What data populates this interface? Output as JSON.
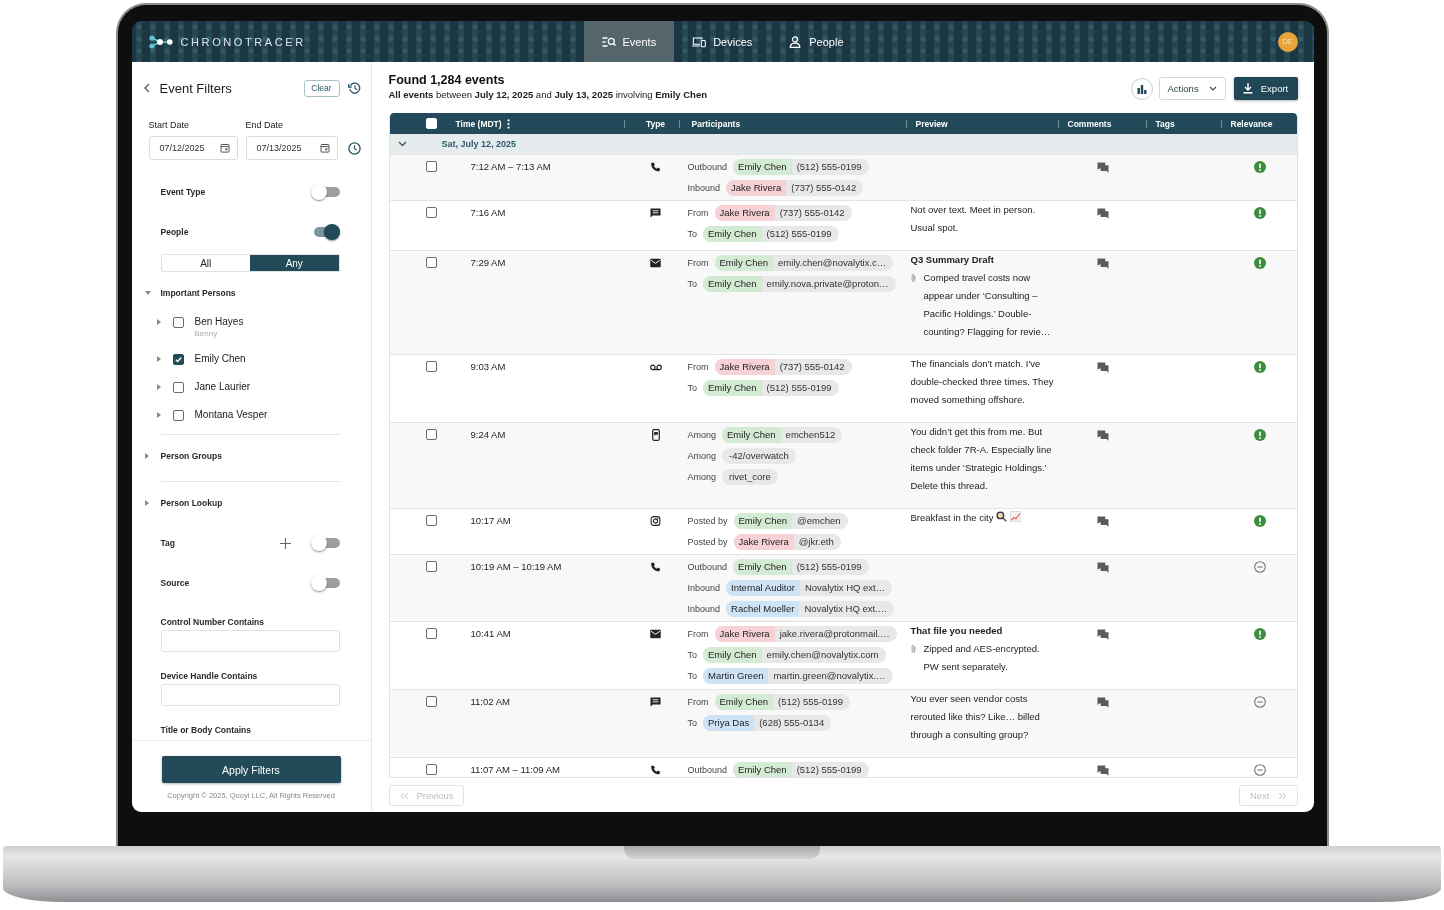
{
  "app": {
    "brand": "CHRONOTRACER",
    "nav": [
      {
        "label": "Events",
        "kind": "events",
        "selected": true
      },
      {
        "label": "Devices",
        "kind": "devices",
        "selected": false
      },
      {
        "label": "People",
        "kind": "people",
        "selected": false
      }
    ],
    "avatar": "DE"
  },
  "sidebar": {
    "title": "Event Filters",
    "clear_label": "Clear",
    "dates": [
      {
        "label": "Start Date",
        "value": "07/12/2025"
      },
      {
        "label": "End Date",
        "value": "07/13/2025"
      }
    ],
    "filters": [
      {
        "kind": "toggle",
        "label": "Event Type",
        "on": false
      },
      {
        "kind": "toggle",
        "label": "People",
        "on": true
      },
      {
        "kind": "segmented",
        "options": [
          {
            "label": "All",
            "selected": false
          },
          {
            "label": "Any",
            "selected": true
          }
        ]
      },
      {
        "kind": "section",
        "label": "Important Persons",
        "expanded": true,
        "children": [
          {
            "name": "Ben Hayes",
            "alias": "Benny",
            "checked": false,
            "expanded": false
          },
          {
            "name": "Emily Chen",
            "checked": true,
            "expanded": false
          },
          {
            "name": "Jane Laurier",
            "checked": false,
            "expanded": false
          },
          {
            "name": "Montana Vesper",
            "checked": false,
            "expanded": false
          }
        ]
      },
      {
        "kind": "section",
        "label": "Person Groups",
        "expanded": false
      },
      {
        "kind": "section",
        "label": "Person Lookup",
        "expanded": false
      },
      {
        "kind": "toggle",
        "label": "Tag",
        "on": false,
        "add_button": true
      },
      {
        "kind": "toggle",
        "label": "Source",
        "on": false
      },
      {
        "kind": "field",
        "label": "Control Number Contains"
      },
      {
        "kind": "field",
        "label": "Device Handle Contains"
      },
      {
        "kind": "heading",
        "label": "Title or Body Contains"
      }
    ],
    "apply_label": "Apply Filters",
    "copyright": "Copyright © 2025, Quoyi LLC, All Rights Reserved"
  },
  "results": {
    "title": "Found 1,284 events",
    "subtitle": "**All events** between **July 12, 2025** and **July 13, 2025** involving **Emily Chen**",
    "actions": [
      {
        "kind": "chart"
      },
      {
        "kind": "menu",
        "label": "Actions"
      },
      {
        "kind": "export",
        "label": "Export"
      }
    ]
  },
  "table": {
    "select_all": {
      "checked": false
    },
    "columns": [
      {
        "label": "Time (MDT)",
        "menu": true
      },
      {
        "label": "Type"
      },
      {
        "label": "Participants"
      },
      {
        "label": "Preview"
      },
      {
        "label": "Comments"
      },
      {
        "label": "Tags"
      },
      {
        "label": "Relevance"
      }
    ],
    "group": {
      "label": "Sat, July 12, 2025",
      "expanded": true
    },
    "rows": [
      {
        "time": "7:12 AM – 7:13 AM",
        "kind": "call",
        "selected": false,
        "participants": [
          {
            "role": "Outbound",
            "name": "Emily Chen",
            "color": "#d4ebd3",
            "handle": "(512) 555-0199"
          },
          {
            "role": "Inbound",
            "name": "Jake Rivera",
            "color": "#f6d1d5",
            "handle": "(737) 555-0142"
          }
        ],
        "flagged": true
      },
      {
        "time": "7:16 AM",
        "kind": "message",
        "selected": false,
        "participants": [
          {
            "role": "From",
            "name": "Jake Rivera",
            "color": "#f6d1d5",
            "handle": "(737) 555-0142"
          },
          {
            "role": "To",
            "name": "Emily Chen",
            "color": "#d4ebd3",
            "handle": "(512) 555-0199"
          }
        ],
        "preview": {
          "text": "Not over text. Meet in person. Usual spot."
        },
        "flagged": true
      },
      {
        "time": "7:29 AM",
        "kind": "email",
        "selected": false,
        "participants": [
          {
            "role": "From",
            "name": "Emily Chen",
            "color": "#d4ebd3",
            "handle": "emily.chen@novalytix.c…"
          },
          {
            "role": "To",
            "name": "Emily Chen",
            "color": "#d4ebd3",
            "handle": "emily.nova.private@proton…"
          }
        ],
        "preview": {
          "title": "Q3 Summary Draft",
          "attachment": true,
          "text": "Comped travel costs now appear under ‘Consulting – Pacific Holdings.’ Double-counting? Flagging for revie…"
        },
        "flagged": true
      },
      {
        "time": "9:03 AM",
        "kind": "voicemail",
        "selected": false,
        "participants": [
          {
            "role": "From",
            "name": "Jake Rivera",
            "color": "#f6d1d5",
            "handle": "(737) 555-0142"
          },
          {
            "role": "To",
            "name": "Emily Chen",
            "color": "#d4ebd3",
            "handle": "(512) 555-0199"
          }
        ],
        "preview": {
          "text": "The financials don't match. I've double-checked three times. They moved something offshore."
        },
        "flagged": true
      },
      {
        "time": "9:24 AM",
        "kind": "app",
        "selected": false,
        "participants": [
          {
            "role": "Among",
            "name": "Emily Chen",
            "color": "#d4ebd3",
            "handle": "emchen512"
          },
          {
            "role": "Among",
            "handle": "-42/overwatch"
          },
          {
            "role": "Among",
            "handle": "rivet_core"
          }
        ],
        "preview": {
          "text": "You didn’t get this from me. But check folder 7R-A. Especially line items under ‘Strategic Holdings.’ Delete this thread."
        },
        "flagged": true
      },
      {
        "time": "10:17 AM",
        "kind": "social",
        "selected": false,
        "participants": [
          {
            "role": "Posted by",
            "name": "Emily Chen",
            "color": "#d4ebd3",
            "handle": "@emchen"
          },
          {
            "role": "Posted by",
            "name": "Jake Rivera",
            "color": "#f6d1d5",
            "handle": "@jkr.eth"
          }
        ],
        "preview": {
          "text": "Breakfast in the city",
          "emoji": [
            {
              "kind": "pan"
            },
            {
              "kind": "chart"
            }
          ]
        },
        "flagged": true
      },
      {
        "time": "10:19 AM – 10:19 AM",
        "kind": "call",
        "selected": false,
        "participants": [
          {
            "role": "Outbound",
            "name": "Emily Chen",
            "color": "#d4ebd3",
            "handle": "(512) 555-0199"
          },
          {
            "role": "Inbound",
            "name": "Internal Auditor",
            "color": "#cfe3f6",
            "handle": "Novalytix HQ ext…"
          },
          {
            "role": "Inbound",
            "name": "Rachel Moeller",
            "color": "#cfe3f6",
            "handle": "Novalytix HQ ext.…"
          }
        ],
        "flagged": false
      },
      {
        "time": "10:41 AM",
        "kind": "email",
        "selected": false,
        "participants": [
          {
            "role": "From",
            "name": "Jake Rivera",
            "color": "#f6d1d5",
            "handle": "jake.rivera@protonmail.…"
          },
          {
            "role": "To",
            "name": "Emily Chen",
            "color": "#d4ebd3",
            "handle": "emily.chen@novalytix.com"
          },
          {
            "role": "To",
            "name": "Martin Green",
            "color": "#cfe3f6",
            "handle": "martin.green@novalytix.…"
          }
        ],
        "preview": {
          "title": "That file you needed",
          "attachment": true,
          "text": "Zipped and AES-encrypted. PW sent separately."
        },
        "flagged": true
      },
      {
        "time": "11:02 AM",
        "kind": "message",
        "selected": false,
        "participants": [
          {
            "role": "From",
            "name": "Emily Chen",
            "color": "#d4ebd3",
            "handle": "(512) 555-0199"
          },
          {
            "role": "To",
            "name": "Priya Das",
            "color": "#cfe3f6",
            "handle": "(628) 555-0134"
          }
        ],
        "preview": {
          "text": "You ever seen vendor costs rerouted like this? Like… billed through a consulting group?"
        },
        "flagged": false
      },
      {
        "time": "11:07 AM – 11:09 AM",
        "kind": "call",
        "selected": false,
        "participants": [
          {
            "role": "Outbound",
            "name": "Emily Chen",
            "color": "#d4ebd3",
            "handle": "(512) 555-0199"
          }
        ],
        "flagged": false
      }
    ]
  },
  "pagination": {
    "previous": {
      "label": "Previous",
      "disabled": true
    },
    "next": {
      "label": "Next",
      "disabled": true
    }
  }
}
